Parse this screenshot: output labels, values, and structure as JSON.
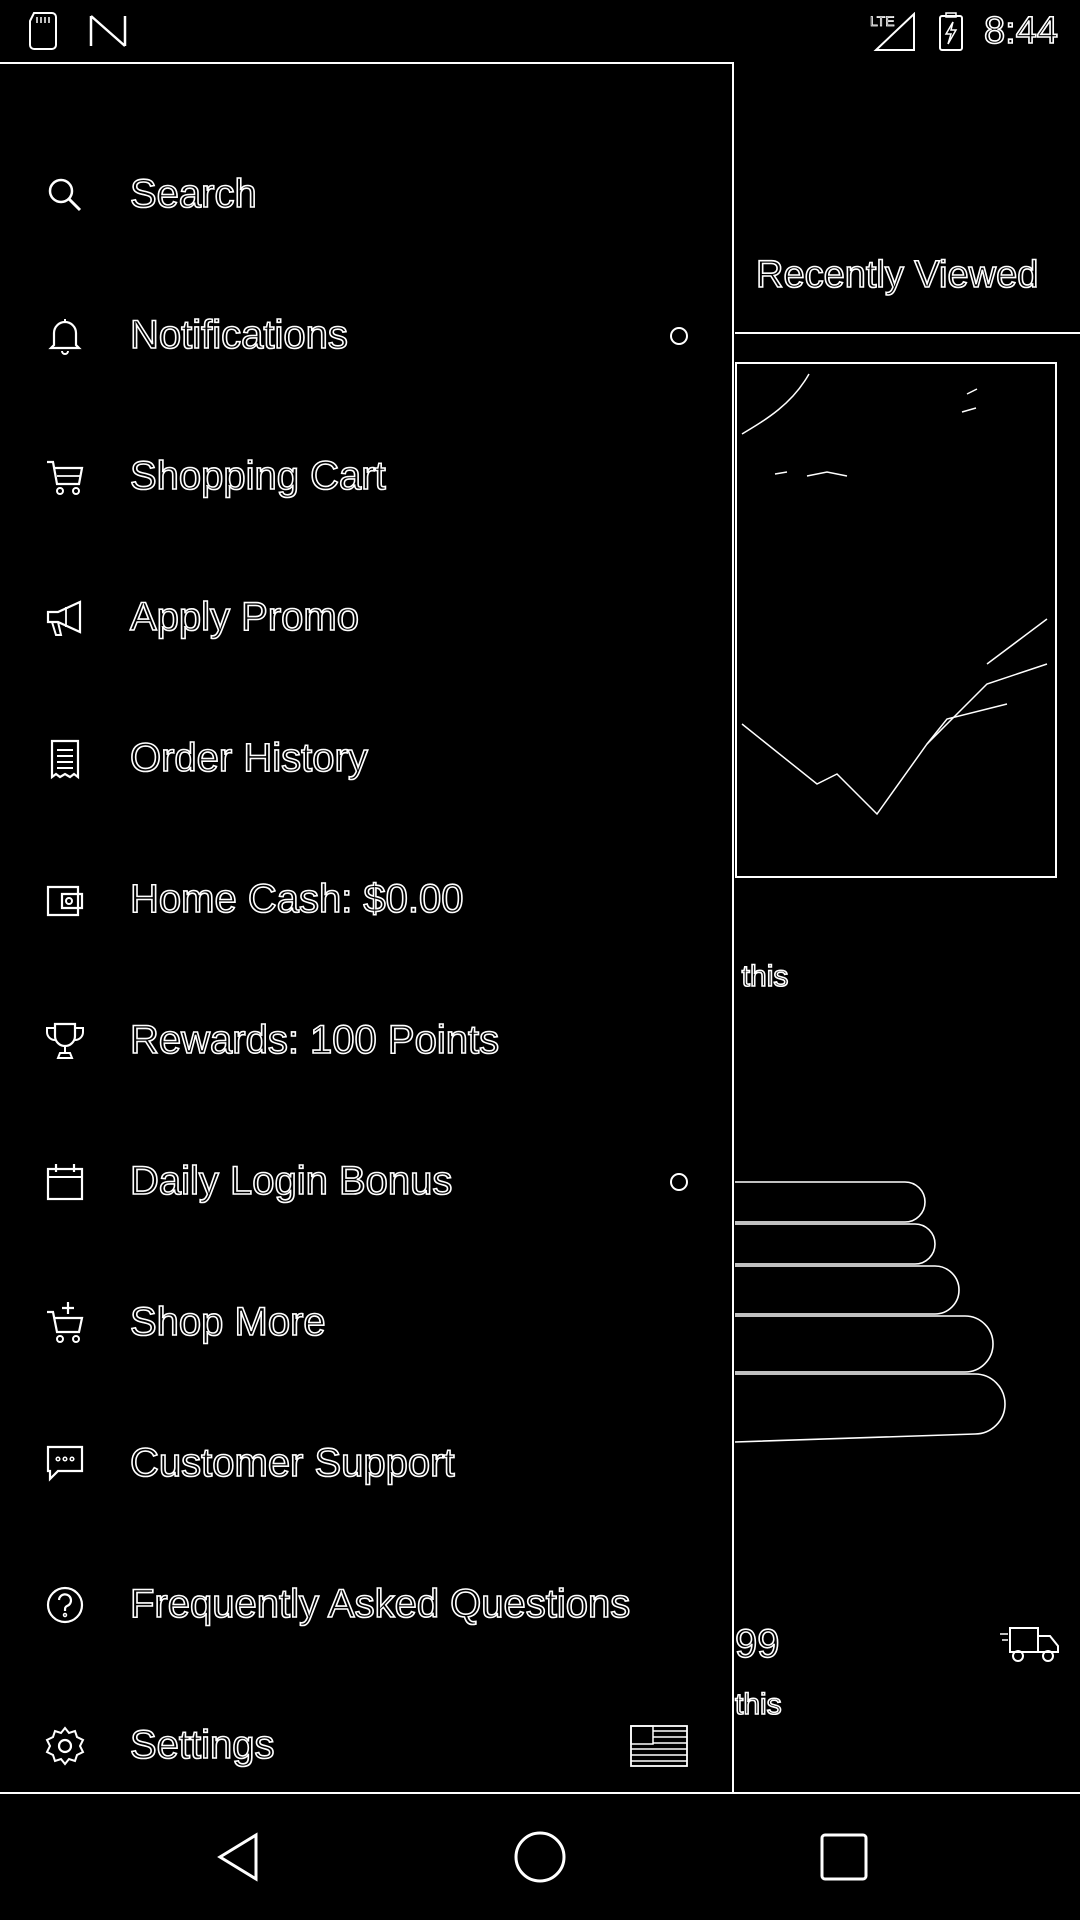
{
  "status_bar": {
    "time": "8:44",
    "network": "LTE",
    "left_icons": [
      "sd-card-icon",
      "n-logo-icon"
    ],
    "right_icons": [
      "signal-icon",
      "battery-charging-icon"
    ]
  },
  "background": {
    "tab_label": "Recently Viewed",
    "snippet_1": ": this",
    "price_fragment": "99",
    "snippet_2": "this"
  },
  "drawer": {
    "items": [
      {
        "label": "Search",
        "icon": "search-icon"
      },
      {
        "label": "Notifications",
        "icon": "bell-icon",
        "indicator": true
      },
      {
        "label": "Shopping Cart",
        "icon": "cart-icon"
      },
      {
        "label": "Apply Promo",
        "icon": "megaphone-icon"
      },
      {
        "label": "Order History",
        "icon": "receipt-icon"
      },
      {
        "label": "Home Cash: $0.00",
        "icon": "wallet-icon"
      },
      {
        "label": "Rewards: 100 Points",
        "icon": "trophy-icon"
      },
      {
        "label": "Daily Login Bonus",
        "icon": "calendar-icon",
        "indicator": true
      },
      {
        "label": "Shop More",
        "icon": "cart-plus-icon"
      },
      {
        "label": "Customer Support",
        "icon": "chat-icon"
      },
      {
        "label": "Frequently Asked Questions",
        "icon": "help-icon"
      },
      {
        "label": "Settings",
        "icon": "gear-icon",
        "trailing": "us-flag-icon"
      }
    ]
  },
  "nav_bar": {
    "buttons": [
      "back-icon",
      "home-icon",
      "recents-icon"
    ]
  },
  "colors": {
    "background": "#000000",
    "outline": "#ffffff"
  }
}
